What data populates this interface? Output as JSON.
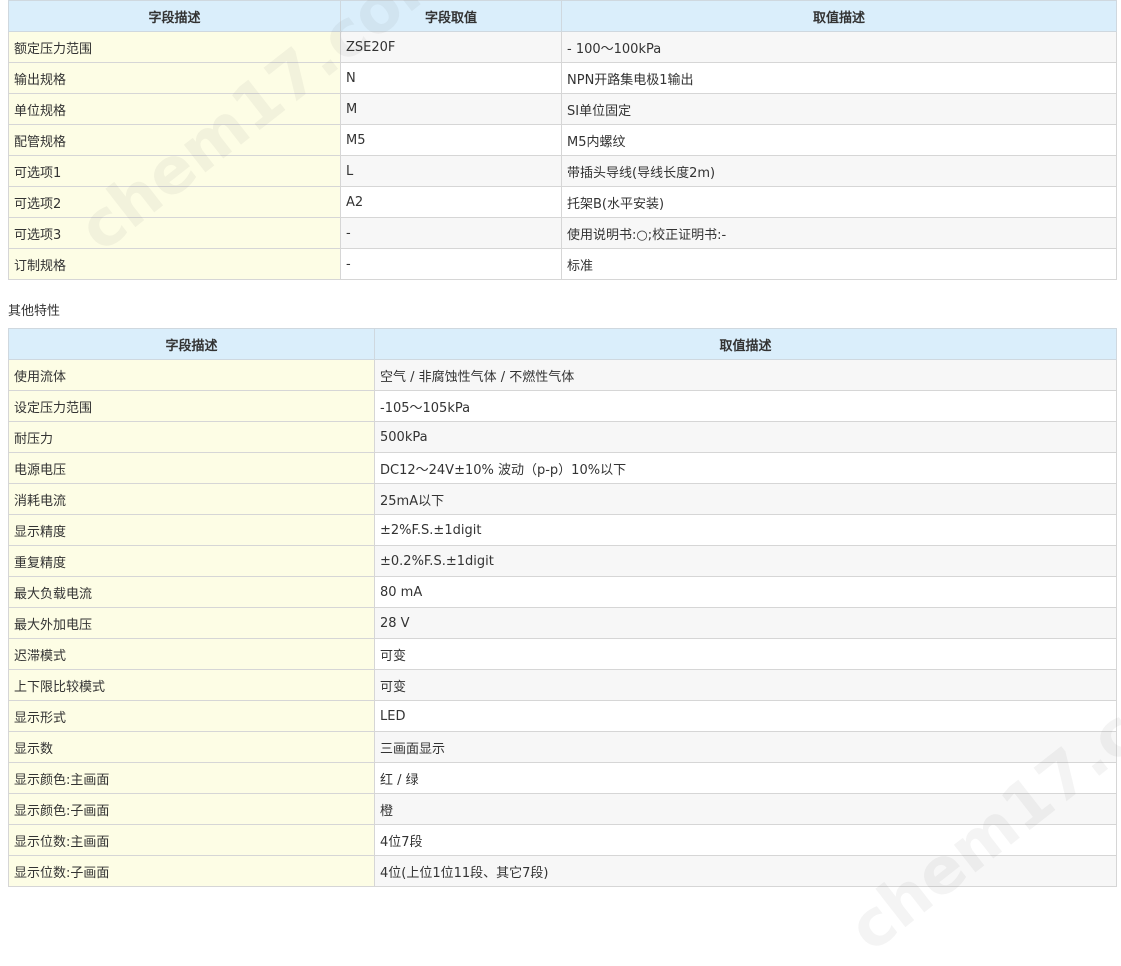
{
  "table1": {
    "headers": [
      "字段描述",
      "字段取值",
      "取值描述"
    ],
    "rows": [
      [
        "额定压力范围",
        "ZSE20F",
        "- 100～100kPa"
      ],
      [
        "输出规格",
        "N",
        "NPN开路集电极1输出"
      ],
      [
        "单位规格",
        "M",
        "SI单位固定"
      ],
      [
        "配管规格",
        "M5",
        "M5内螺纹"
      ],
      [
        "可选项1",
        "L",
        "带插头导线(导线长度2m)"
      ],
      [
        "可选项2",
        "A2",
        "托架B(水平安装)"
      ],
      [
        "可选项3",
        "-",
        "使用说明书:○;校正证明书:-"
      ],
      [
        "订制规格",
        "-",
        "标准"
      ]
    ]
  },
  "section_title": "其他特性",
  "table2": {
    "headers": [
      "字段描述",
      "取值描述"
    ],
    "rows": [
      [
        "使用流体",
        "空气 / 非腐蚀性气体 / 不燃性气体"
      ],
      [
        "设定压力范围",
        "-105～105kPa"
      ],
      [
        "耐压力",
        "500kPa"
      ],
      [
        "电源电压",
        "DC12～24V±10% 波动（p-p）10%以下"
      ],
      [
        "消耗电流",
        "25mA以下"
      ],
      [
        "显示精度",
        "±2%F.S.±1digit"
      ],
      [
        "重复精度",
        "±0.2%F.S.±1digit"
      ],
      [
        "最大负载电流",
        "80 mA"
      ],
      [
        "最大外加电压",
        "28 V"
      ],
      [
        "迟滞模式",
        "可变"
      ],
      [
        "上下限比较模式",
        "可变"
      ],
      [
        "显示形式",
        "LED"
      ],
      [
        "显示数",
        "三画面显示"
      ],
      [
        "显示颜色:主画面",
        "红 / 绿"
      ],
      [
        "显示颜色:子画面",
        "橙"
      ],
      [
        "显示位数:主画面",
        "4位7段"
      ],
      [
        "显示位数:子画面",
        "4位(上位1位11段、其它7段)"
      ]
    ]
  },
  "watermark": "chem17.com"
}
